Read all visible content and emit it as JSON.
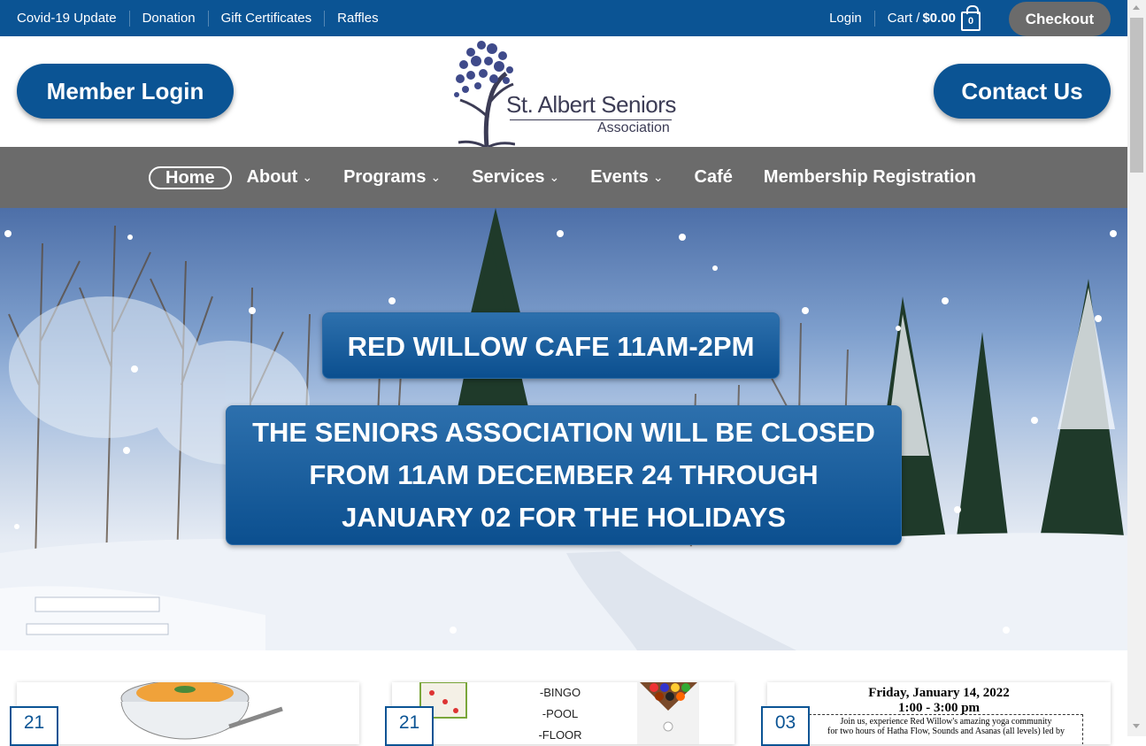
{
  "topbar": {
    "links": [
      "Covid-19 Update",
      "Donation",
      "Gift Certificates",
      "Raffles"
    ],
    "login": "Login",
    "cart_label": "Cart /",
    "cart_total": "$0.00",
    "cart_count": "0",
    "checkout": "Checkout"
  },
  "header": {
    "member_login": "Member Login",
    "contact_us": "Contact Us",
    "logo_name": "St. Albert Seniors",
    "logo_sub": "Association"
  },
  "nav": {
    "items": [
      "Home",
      "About",
      "Programs",
      "Services",
      "Events",
      "Café",
      "Membership Registration"
    ],
    "active": "Home"
  },
  "hero": {
    "banner1": "RED WILLOW CAFE 11AM-2PM",
    "banner2_lines": [
      "THE SENIORS ASSOCIATION WILL BE CLOSED",
      "FROM 11AM DECEMBER 24 THROUGH",
      "JANUARY 02 FOR THE HOLIDAYS"
    ]
  },
  "cards": [
    {
      "day": "21"
    },
    {
      "day": "21",
      "lines": [
        "-BINGO",
        "-POOL",
        "-FLOOR CURLING"
      ]
    },
    {
      "day": "03",
      "title": "Friday, January 14, 2022",
      "time": "1:00 - 3:00 pm",
      "body1": "Join us, experience Red Willow's amazing yoga community",
      "body2": "for two hours of Hatha Flow, Sounds and Asanas (all levels) led by"
    }
  ],
  "colors": {
    "brand_blue": "#0b5494",
    "nav_gray": "#6b6b6b"
  }
}
